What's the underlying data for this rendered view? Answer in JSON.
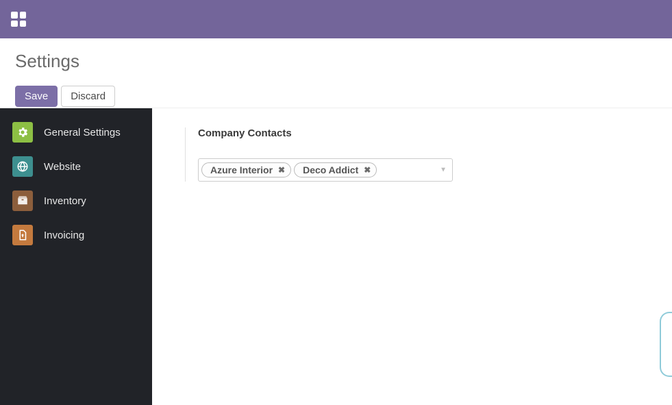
{
  "header": {
    "title": "Settings",
    "save_label": "Save",
    "discard_label": "Discard"
  },
  "sidebar": {
    "items": [
      {
        "label": "General Settings"
      },
      {
        "label": "Website"
      },
      {
        "label": "Inventory"
      },
      {
        "label": "Invoicing"
      }
    ]
  },
  "main": {
    "section_title": "Company Contacts",
    "tags": [
      {
        "label": "Azure Interior"
      },
      {
        "label": "Deco Addict"
      }
    ]
  }
}
